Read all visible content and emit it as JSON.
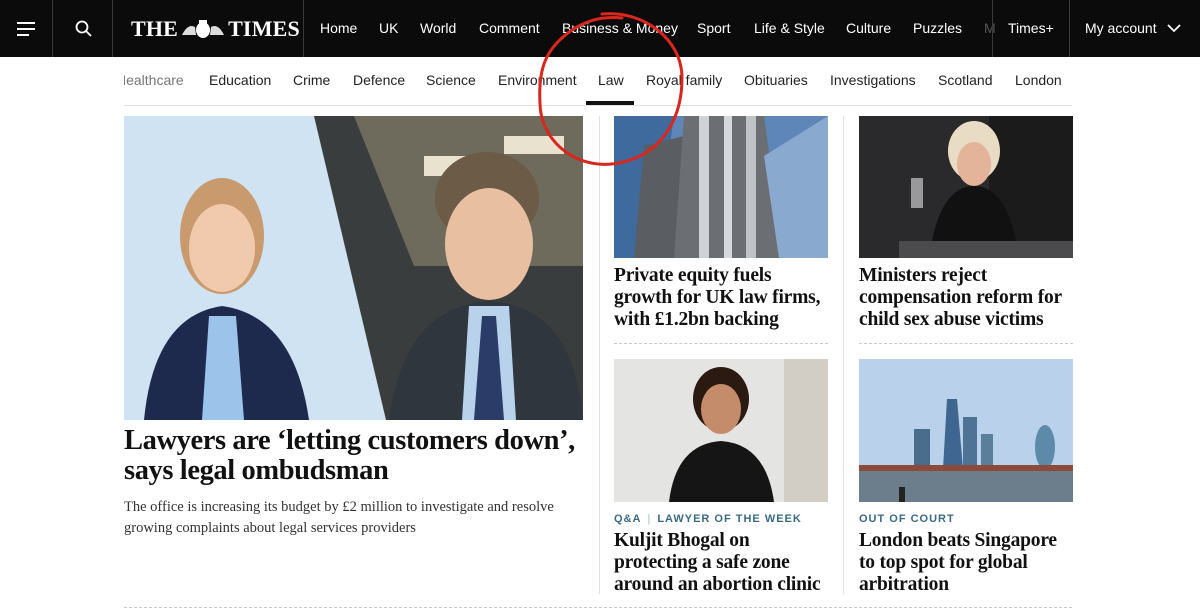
{
  "header": {
    "logo_left": "THE",
    "logo_right": "TIMES",
    "nav_items": [
      "Home",
      "UK",
      "World",
      "Comment",
      "Business & Money",
      "Sport",
      "Life & Style",
      "Culture",
      "Puzzles",
      "M"
    ],
    "times_plus": "Times+",
    "account": "My account"
  },
  "section_nav": {
    "items": [
      "Healthcare",
      "Education",
      "Crime",
      "Defence",
      "Science",
      "Environment",
      "Law",
      "Royal family",
      "Obituaries",
      "Investigations",
      "Scotland",
      "London"
    ],
    "active": "Law"
  },
  "lead": {
    "title": "Lawyers are ‘letting customers down’, says legal ombudsman",
    "summary": "The office is increasing its budget by £2 million to investigate and resolve growing complaints about legal services providers"
  },
  "cards": [
    {
      "kicker": "",
      "kicker2": "",
      "title": "Private equity fuels growth for UK law firms, with £1.2bn backing"
    },
    {
      "kicker": "",
      "kicker2": "",
      "title": "Ministers reject compensation reform for child sex abuse victims"
    },
    {
      "kicker": "Q&A",
      "kicker2": "LAWYER OF THE WEEK",
      "title": "Kuljit Bhogal on protecting a safe zone around an abortion clinic"
    },
    {
      "kicker": "OUT OF COURT",
      "kicker2": "",
      "title": "London beats Singapore to top spot for global arbitration"
    }
  ],
  "icons": {
    "menu": "hamburger-menu-icon",
    "search": "search-icon",
    "account": "chevron-down-icon"
  },
  "colors": {
    "header_bg": "#0b0b0b",
    "kicker": "#3a6a82",
    "annotation": "#d8271c"
  }
}
